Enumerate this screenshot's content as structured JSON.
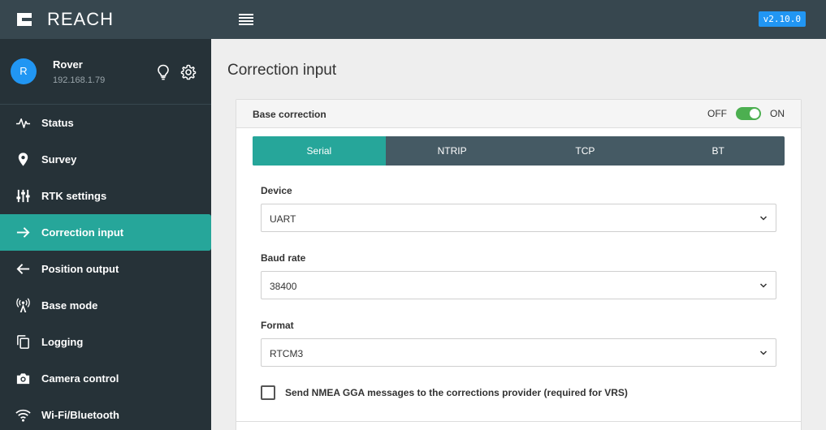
{
  "app": {
    "name": "REACH",
    "version": "v2.10.0"
  },
  "device": {
    "avatar_letter": "R",
    "name": "Rover",
    "ip": "192.168.1.79"
  },
  "nav": {
    "items": [
      {
        "label": "Status",
        "icon": "pulse-icon"
      },
      {
        "label": "Survey",
        "icon": "location-pin-icon"
      },
      {
        "label": "RTK settings",
        "icon": "sliders-icon"
      },
      {
        "label": "Correction input",
        "icon": "arrow-right-icon",
        "active": true
      },
      {
        "label": "Position output",
        "icon": "arrow-left-icon"
      },
      {
        "label": "Base mode",
        "icon": "antenna-icon"
      },
      {
        "label": "Logging",
        "icon": "copy-icon"
      },
      {
        "label": "Camera control",
        "icon": "camera-icon"
      },
      {
        "label": "Wi-Fi/Bluetooth",
        "icon": "wifi-icon"
      }
    ]
  },
  "page": {
    "title": "Correction input"
  },
  "card": {
    "title": "Base correction",
    "toggle": {
      "off_label": "OFF",
      "on_label": "ON",
      "state": "on"
    },
    "tabs": [
      {
        "label": "Serial",
        "active": true
      },
      {
        "label": "NTRIP"
      },
      {
        "label": "TCP"
      },
      {
        "label": "BT"
      }
    ],
    "fields": {
      "device": {
        "label": "Device",
        "value": "UART"
      },
      "baud": {
        "label": "Baud rate",
        "value": "38400"
      },
      "format": {
        "label": "Format",
        "value": "RTCM3"
      }
    },
    "checkbox": {
      "label": "Send NMEA GGA messages to the corrections provider (required for VRS)",
      "checked": false
    }
  },
  "colors": {
    "topbar": "#37474f",
    "sidebar": "#263238",
    "accent": "#26a69a",
    "tab_bar": "#455a64",
    "version_badge": "#2196f3",
    "toggle_on": "#4caf50"
  }
}
